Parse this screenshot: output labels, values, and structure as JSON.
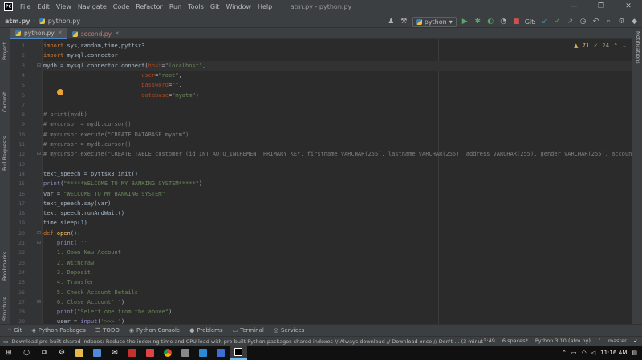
{
  "app": {
    "icon_label": "PC",
    "window_title": "atm.py - python.py",
    "menu": [
      "File",
      "Edit",
      "View",
      "Navigate",
      "Code",
      "Refactor",
      "Run",
      "Tools",
      "Git",
      "Window",
      "Help"
    ],
    "window_controls": [
      "—",
      "❐",
      "✕"
    ]
  },
  "navbar": {
    "project": "atm.py",
    "file": "python.py",
    "run_config": "python",
    "git_label": "Git:"
  },
  "left_tools": [
    "Project",
    "Commit",
    "Pull Requests",
    "Bookmarks",
    "Structure"
  ],
  "right_tools": [
    "Notifications"
  ],
  "tabs": [
    {
      "label": "python.py",
      "active": true
    },
    {
      "label": "second.py",
      "active": false
    }
  ],
  "inspections": {
    "warnings": "71",
    "weak": "24"
  },
  "code_lines": [
    {
      "n": "1",
      "segs": [
        [
          "kw",
          "import"
        ],
        [
          "plain",
          " sys,random,time,pyttsx3"
        ]
      ]
    },
    {
      "n": "2",
      "segs": [
        [
          "kw",
          "import"
        ],
        [
          "plain",
          " mysql.connector"
        ]
      ]
    },
    {
      "n": "3",
      "segs": [
        [
          "plain",
          "mydb = mysql.connector.connect("
        ],
        [
          "pn",
          "host"
        ],
        [
          "plain",
          "="
        ],
        [
          "str",
          "\"localhost\""
        ],
        [
          "plain",
          ","
        ]
      ],
      "current": true
    },
    {
      "n": "4",
      "segs": [
        [
          "plain",
          "                             "
        ],
        [
          "pn",
          "user"
        ],
        [
          "plain",
          "="
        ],
        [
          "str",
          "\"root\""
        ],
        [
          "plain",
          ","
        ]
      ]
    },
    {
      "n": "5",
      "segs": [
        [
          "plain",
          "                             "
        ],
        [
          "pn",
          "password"
        ],
        [
          "plain",
          "="
        ],
        [
          "str",
          "\"\""
        ],
        [
          "plain",
          ","
        ]
      ]
    },
    {
      "n": "6",
      "segs": [
        [
          "plain",
          "                             "
        ],
        [
          "pn",
          "database"
        ],
        [
          "plain",
          "="
        ],
        [
          "str",
          "\"myatm\""
        ],
        [
          "plain",
          ")"
        ]
      ]
    },
    {
      "n": "7",
      "segs": []
    },
    {
      "n": "8",
      "segs": [
        [
          "cm",
          "# print(mydb)"
        ]
      ]
    },
    {
      "n": "9",
      "segs": [
        [
          "cm",
          "# mycursor = mydb.cursor()"
        ]
      ]
    },
    {
      "n": "10",
      "segs": [
        [
          "cm",
          "# mycursor.execute(\"CREATE DATABASE myatm\")"
        ]
      ]
    },
    {
      "n": "11",
      "segs": [
        [
          "cm",
          "# mycursor = mydb.cursor()"
        ]
      ]
    },
    {
      "n": "12",
      "segs": [
        [
          "cm",
          "# mycursor.execute(\"CREATE TABLE customer (id INT AUTO_INCREMENT PRIMARY KEY, firstname VARCHAR(255), lastname VARCHAR(255), address VARCHAR(255), gender VARCHAR(255), account_type"
        ]
      ]
    },
    {
      "n": "13",
      "segs": []
    },
    {
      "n": "14",
      "segs": [
        [
          "plain",
          "text_speech = pyttsx3.init()"
        ]
      ]
    },
    {
      "n": "15",
      "segs": [
        [
          "bi",
          "print"
        ],
        [
          "plain",
          "("
        ],
        [
          "str",
          "\"*****WELCOME TO MY BANKING SYSTEM*****\""
        ],
        [
          "plain",
          ")"
        ]
      ]
    },
    {
      "n": "16",
      "segs": [
        [
          "plain",
          "var = "
        ],
        [
          "str",
          "\"WELCOME TO MY BANKING SYSTEM\""
        ]
      ]
    },
    {
      "n": "17",
      "segs": [
        [
          "plain",
          "text_speech.say(var)"
        ]
      ]
    },
    {
      "n": "18",
      "segs": [
        [
          "plain",
          "text_speech.runAndWait()"
        ]
      ]
    },
    {
      "n": "19",
      "segs": [
        [
          "plain",
          "time.sleep("
        ],
        [
          "num",
          "1"
        ],
        [
          "plain",
          ")"
        ]
      ]
    },
    {
      "n": "20",
      "segs": [
        [
          "kw",
          "def "
        ],
        [
          "fn",
          "open"
        ],
        [
          "plain",
          "():"
        ]
      ]
    },
    {
      "n": "21",
      "segs": [
        [
          "plain",
          "    "
        ],
        [
          "bi",
          "print"
        ],
        [
          "plain",
          "("
        ],
        [
          "str",
          "'''"
        ]
      ]
    },
    {
      "n": "22",
      "segs": [
        [
          "str",
          "    1. Open New Account"
        ]
      ]
    },
    {
      "n": "23",
      "segs": [
        [
          "str",
          "    2. Withdraw"
        ]
      ]
    },
    {
      "n": "24",
      "segs": [
        [
          "str",
          "    3. Deposit"
        ]
      ]
    },
    {
      "n": "25",
      "segs": [
        [
          "str",
          "    4. Transfer"
        ]
      ]
    },
    {
      "n": "26",
      "segs": [
        [
          "str",
          "    5. Check Account Details"
        ]
      ]
    },
    {
      "n": "27",
      "segs": [
        [
          "str",
          "    6. Close Account'''"
        ],
        [
          "plain",
          ")"
        ]
      ]
    },
    {
      "n": "28",
      "segs": [
        [
          "plain",
          "    "
        ],
        [
          "bi",
          "print"
        ],
        [
          "plain",
          "("
        ],
        [
          "str",
          "\"Select one from the above\""
        ],
        [
          "plain",
          ")"
        ]
      ]
    },
    {
      "n": "29",
      "segs": [
        [
          "plain",
          "    user = "
        ],
        [
          "bi",
          "input"
        ],
        [
          "plain",
          "("
        ],
        [
          "str",
          "'>>> '"
        ],
        [
          "plain",
          ")"
        ]
      ]
    }
  ],
  "bottom_tools": [
    {
      "icon": "⑂",
      "label": "Git"
    },
    {
      "icon": "◈",
      "label": "Python Packages"
    },
    {
      "icon": "☰",
      "label": "TODO"
    },
    {
      "icon": "◉",
      "label": "Python Console"
    },
    {
      "icon": "●",
      "label": "Problems"
    },
    {
      "icon": "▭",
      "label": "Terminal"
    },
    {
      "icon": "◎",
      "label": "Services"
    }
  ],
  "status": {
    "message": "Download pre-built shared indexes: Reduce the indexing time and CPU load with pre-built Python packages shared indexes // Always download // Download once // Don't ... (3 minutes ago)",
    "position": "3:49",
    "indent": "6 spaces*",
    "interpreter": "Python 3.10 (atm.py)",
    "branch": "master"
  },
  "taskbar": {
    "time": "11:16 AM"
  },
  "colors": {
    "editor_bg": "#2b2b2b",
    "keyword": "#cc7832",
    "string": "#6a8759",
    "comment": "#808080",
    "function": "#ffc66d",
    "accent": "#4a88c7"
  }
}
